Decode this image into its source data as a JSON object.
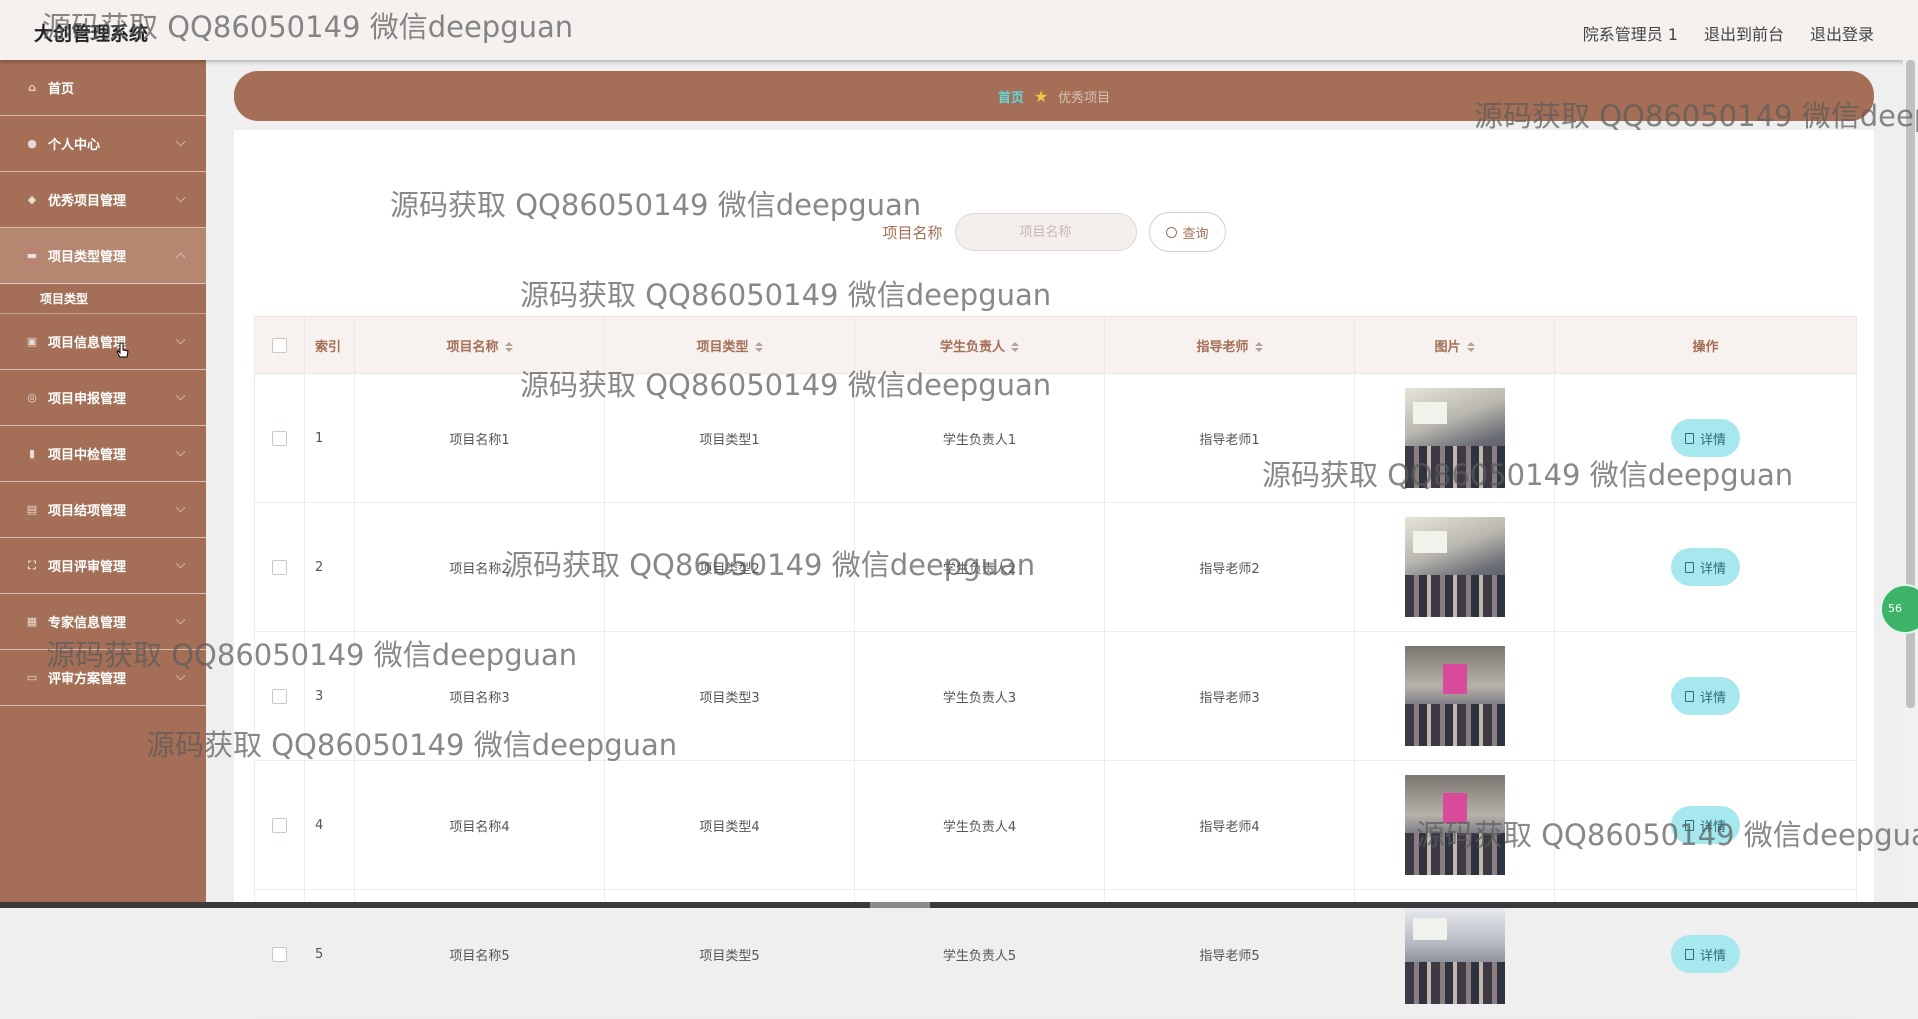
{
  "app": {
    "title": "大创管理系统"
  },
  "top_links": {
    "user": "院系管理员 1",
    "front": "退出到前台",
    "logout": "退出登录"
  },
  "sidebar": {
    "items": [
      {
        "label": "首页",
        "icon": "home-icon"
      },
      {
        "label": "个人中心",
        "icon": "user-icon"
      },
      {
        "label": "优秀项目管理",
        "icon": "award-icon"
      },
      {
        "label": "项目类型管理",
        "icon": "folder-icon"
      },
      {
        "label": "项目信息管理",
        "icon": "info-icon"
      },
      {
        "label": "项目申报管理",
        "icon": "apply-icon"
      },
      {
        "label": "项目中检管理",
        "icon": "mic-icon"
      },
      {
        "label": "项目结项管理",
        "icon": "finish-icon"
      },
      {
        "label": "项目评审管理",
        "icon": "review-icon"
      },
      {
        "label": "专家信息管理",
        "icon": "expert-icon"
      },
      {
        "label": "评审方案管理",
        "icon": "plan-icon"
      }
    ],
    "submenu": "项目类型"
  },
  "breadcrumb": {
    "home": "首页",
    "current": "优秀项目"
  },
  "search": {
    "label": "项目名称",
    "placeholder": "项目名称",
    "button": "查询"
  },
  "table": {
    "headers": [
      "索引",
      "项目名称",
      "项目类型",
      "学生负责人",
      "指导老师",
      "图片",
      "操作"
    ],
    "rows": [
      {
        "index": "1",
        "name": "项目名称1",
        "type": "项目类型1",
        "student": "学生负责人1",
        "teacher": "指导老师1",
        "action": "详情"
      },
      {
        "index": "2",
        "name": "项目名称2",
        "type": "项目类型2",
        "student": "学生负责人2",
        "teacher": "指导老师2",
        "action": "详情"
      },
      {
        "index": "3",
        "name": "项目名称3",
        "type": "项目类型3",
        "student": "学生负责人3",
        "teacher": "指导老师3",
        "action": "详情"
      },
      {
        "index": "4",
        "name": "项目名称4",
        "type": "项目类型4",
        "student": "学生负责人4",
        "teacher": "指导老师4",
        "action": "详情"
      },
      {
        "index": "5",
        "name": "项目名称5",
        "type": "项目类型5",
        "student": "学生负责人5",
        "teacher": "指导老师5",
        "action": "详情"
      }
    ]
  },
  "watermark": "源码获取 QQ86050149 微信deepguan",
  "float_badge": "56"
}
